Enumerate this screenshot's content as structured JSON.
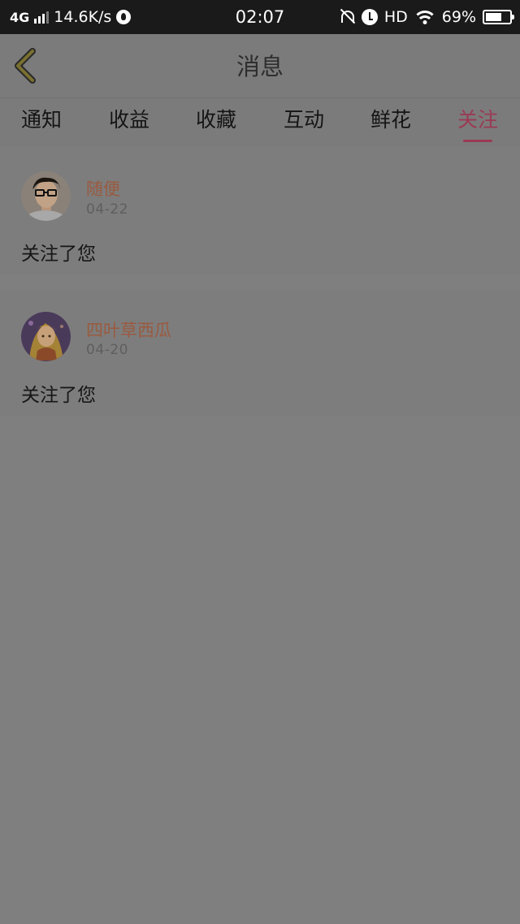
{
  "status_bar": {
    "network": "4G",
    "speed": "14.6K/s",
    "time": "02:07",
    "hd": "HD",
    "battery_percent": "69%",
    "battery_level": 0.69
  },
  "header": {
    "title": "消息",
    "back_icon": "chevron-left-icon"
  },
  "tabs": [
    {
      "label": "通知",
      "active": false
    },
    {
      "label": "收益",
      "active": false
    },
    {
      "label": "收藏",
      "active": false
    },
    {
      "label": "互动",
      "active": false
    },
    {
      "label": "鲜花",
      "active": false
    },
    {
      "label": "关注",
      "active": true
    }
  ],
  "messages": [
    {
      "user": "随便",
      "date": "04-22",
      "text": "关注了您"
    },
    {
      "user": "四叶草西瓜",
      "date": "04-20",
      "text": "关注了您"
    }
  ],
  "colors": {
    "accent": "#9a3a54",
    "username": "#9a5a3f",
    "overlay_bg": "#7f7f7f"
  }
}
